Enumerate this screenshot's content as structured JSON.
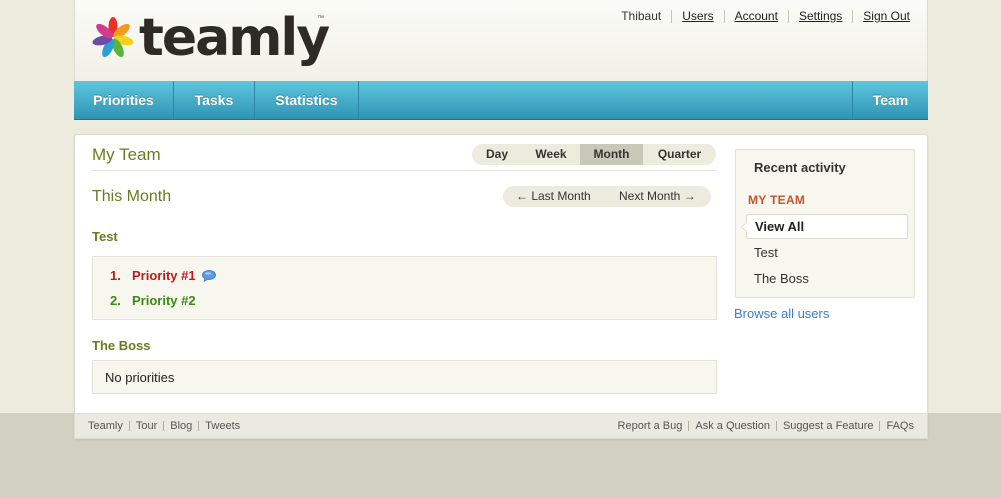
{
  "brand": {
    "name": "teamly",
    "tm": "™"
  },
  "user_nav": {
    "user_name": "Thibaut",
    "links": [
      "Users",
      "Account",
      "Settings",
      "Sign Out"
    ]
  },
  "main_nav": {
    "tabs": [
      "Priorities",
      "Tasks",
      "Statistics"
    ],
    "team_label": "Team"
  },
  "content": {
    "title": "My Team",
    "period_tabs": [
      "Day",
      "Week",
      "Month",
      "Quarter"
    ],
    "active_period": "Month",
    "period_heading": "This Month",
    "pager": {
      "prev": "← Last Month",
      "next": "Next Month →"
    },
    "members": [
      {
        "name": "Test",
        "priorities": [
          {
            "number": "1.",
            "label": "Priority #1",
            "color": "#c11a1a",
            "has_comment": true
          },
          {
            "number": "2.",
            "label": "Priority #2",
            "color": "#3b8a12",
            "has_comment": false
          }
        ]
      },
      {
        "name": "The Boss",
        "empty_text": "No priorities"
      }
    ]
  },
  "sidebar": {
    "title": "Recent activity",
    "section": "MY TEAM",
    "active_item": "View All",
    "items": [
      "Test",
      "The Boss"
    ],
    "browse_link": "Browse all users"
  },
  "footer": {
    "left_links": [
      "Teamly",
      "Tour",
      "Blog",
      "Tweets"
    ],
    "right_links": [
      "Report a Bug",
      "Ask a Question",
      "Suggest a Feature",
      "FAQs"
    ]
  },
  "colors": {
    "accent_olive": "#6d7a24",
    "nav_blue": "#3fa6c4",
    "section_orange": "#c6532a",
    "link_blue": "#3a7fc8"
  }
}
